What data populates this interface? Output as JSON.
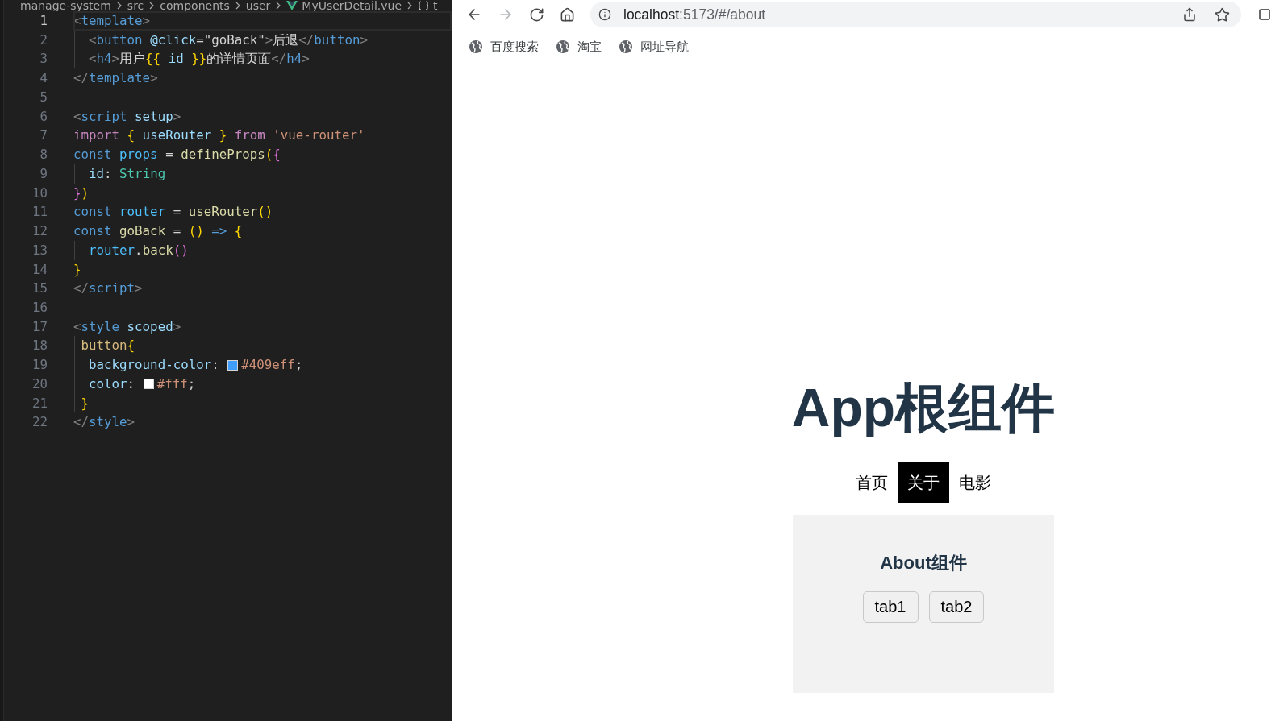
{
  "editor": {
    "breadcrumb": [
      {
        "kind": "folder",
        "label": "manage-system"
      },
      {
        "kind": "folder",
        "label": "src"
      },
      {
        "kind": "folder",
        "label": "components"
      },
      {
        "kind": "folder",
        "label": "user"
      },
      {
        "kind": "file",
        "label": "MyUserDetail.vue"
      },
      {
        "kind": "symbol",
        "label": "t"
      }
    ],
    "lines": [
      {
        "number": "1",
        "current": true,
        "tokens": [
          {
            "kind": "punct",
            "text": "<"
          },
          {
            "kind": "tag",
            "text": "template"
          },
          {
            "kind": "punct",
            "text": ">"
          }
        ]
      },
      {
        "number": "2",
        "current": false,
        "tokens": [
          {
            "kind": "punct",
            "text": "  <"
          },
          {
            "kind": "tag",
            "text": "button"
          },
          {
            "kind": "attr",
            "text": " @click"
          },
          {
            "kind": "text",
            "text": "=\"goBack\""
          },
          {
            "kind": "punct",
            "text": ">"
          },
          {
            "kind": "text",
            "text": "后退"
          },
          {
            "kind": "punct",
            "text": "</"
          },
          {
            "kind": "tag",
            "text": "button"
          },
          {
            "kind": "punct",
            "text": ">"
          }
        ]
      },
      {
        "number": "3",
        "current": false,
        "tokens": [
          {
            "kind": "punct",
            "text": "  <"
          },
          {
            "kind": "tag",
            "text": "h4"
          },
          {
            "kind": "punct",
            "text": ">"
          },
          {
            "kind": "text",
            "text": "用户"
          },
          {
            "kind": "bracket",
            "text": "{{"
          },
          {
            "kind": "variable",
            "text": " id "
          },
          {
            "kind": "bracket",
            "text": "}}"
          },
          {
            "kind": "text",
            "text": "的详情页面"
          },
          {
            "kind": "punct",
            "text": "</"
          },
          {
            "kind": "tag",
            "text": "h4"
          },
          {
            "kind": "punct",
            "text": ">"
          }
        ]
      },
      {
        "number": "4",
        "current": false,
        "tokens": [
          {
            "kind": "punct",
            "text": "</"
          },
          {
            "kind": "tag",
            "text": "template"
          },
          {
            "kind": "punct",
            "text": ">"
          }
        ]
      },
      {
        "number": "5",
        "current": false
      },
      {
        "number": "6",
        "current": false,
        "tokens": [
          {
            "kind": "punct",
            "text": "<"
          },
          {
            "kind": "tag",
            "text": "script"
          },
          {
            "kind": "attr",
            "text": " setup"
          },
          {
            "kind": "punct",
            "text": ">"
          }
        ]
      },
      {
        "number": "7",
        "current": false,
        "tokens": [
          {
            "kind": "control",
            "text": "import"
          },
          {
            "kind": "bracket",
            "text": " {"
          },
          {
            "kind": "variable",
            "text": " useRouter "
          },
          {
            "kind": "bracket",
            "text": "}"
          },
          {
            "kind": "control",
            "text": " from "
          },
          {
            "kind": "string",
            "text": "'vue-router'"
          }
        ]
      },
      {
        "number": "8",
        "current": false,
        "tokens": [
          {
            "kind": "keyword",
            "text": "const"
          },
          {
            "kind": "constant",
            "text": " props"
          },
          {
            "kind": "text",
            "text": " = "
          },
          {
            "kind": "function",
            "text": "defineProps"
          },
          {
            "kind": "bracket",
            "text": "("
          },
          {
            "kind": "bracket2",
            "text": "{"
          }
        ]
      },
      {
        "number": "9",
        "current": false,
        "tokens": [
          {
            "kind": "variable",
            "text": "  id"
          },
          {
            "kind": "text",
            "text": ": "
          },
          {
            "kind": "type",
            "text": "String"
          }
        ]
      },
      {
        "number": "10",
        "current": false,
        "tokens": [
          {
            "kind": "bracket2",
            "text": "}"
          },
          {
            "kind": "bracket",
            "text": ")"
          }
        ]
      },
      {
        "number": "11",
        "current": false,
        "tokens": [
          {
            "kind": "keyword",
            "text": "const"
          },
          {
            "kind": "constant",
            "text": " router"
          },
          {
            "kind": "text",
            "text": " = "
          },
          {
            "kind": "function",
            "text": "useRouter"
          },
          {
            "kind": "bracket",
            "text": "()"
          }
        ]
      },
      {
        "number": "12",
        "current": false,
        "tokens": [
          {
            "kind": "keyword",
            "text": "const"
          },
          {
            "kind": "function",
            "text": " goBack"
          },
          {
            "kind": "text",
            "text": " = "
          },
          {
            "kind": "bracket",
            "text": "()"
          },
          {
            "kind": "keyword",
            "text": " => "
          },
          {
            "kind": "bracket",
            "text": "{"
          }
        ]
      },
      {
        "number": "13",
        "current": false,
        "tokens": [
          {
            "kind": "constant",
            "text": "  router"
          },
          {
            "kind": "text",
            "text": "."
          },
          {
            "kind": "function",
            "text": "back"
          },
          {
            "kind": "bracket2",
            "text": "()"
          }
        ]
      },
      {
        "number": "14",
        "current": false,
        "tokens": [
          {
            "kind": "bracket",
            "text": "}"
          }
        ]
      },
      {
        "number": "15",
        "current": false,
        "tokens": [
          {
            "kind": "punct",
            "text": "</"
          },
          {
            "kind": "tag",
            "text": "script"
          },
          {
            "kind": "punct",
            "text": ">"
          }
        ]
      },
      {
        "number": "16",
        "current": false
      },
      {
        "number": "17",
        "current": false,
        "tokens": [
          {
            "kind": "punct",
            "text": "<"
          },
          {
            "kind": "tag",
            "text": "style"
          },
          {
            "kind": "attr",
            "text": " scoped"
          },
          {
            "kind": "punct",
            "text": ">"
          }
        ]
      },
      {
        "number": "18",
        "current": false,
        "tokens": [
          {
            "kind": "selector",
            "text": " button"
          },
          {
            "kind": "bracket",
            "text": "{"
          }
        ]
      },
      {
        "number": "19",
        "current": false,
        "tokens": [
          {
            "kind": "attr",
            "text": "  background-color"
          },
          {
            "kind": "text",
            "text": ": "
          },
          {
            "kind": "swatch",
            "color": "#409eff"
          },
          {
            "kind": "value",
            "text": "#409eff"
          },
          {
            "kind": "text",
            "text": ";"
          }
        ]
      },
      {
        "number": "20",
        "current": false,
        "tokens": [
          {
            "kind": "attr",
            "text": "  color"
          },
          {
            "kind": "text",
            "text": ": "
          },
          {
            "kind": "swatch",
            "color": "#ffffff"
          },
          {
            "kind": "value",
            "text": "#fff"
          },
          {
            "kind": "text",
            "text": ";"
          }
        ]
      },
      {
        "number": "21",
        "current": false,
        "tokens": [
          {
            "kind": "bracket",
            "text": " }"
          }
        ]
      },
      {
        "number": "22",
        "current": false,
        "tokens": [
          {
            "kind": "punct",
            "text": "</"
          },
          {
            "kind": "tag",
            "text": "style"
          },
          {
            "kind": "punct",
            "text": ">"
          }
        ]
      }
    ]
  },
  "browser": {
    "toolbar": {
      "back": {
        "disabled": false
      },
      "forward": {
        "disabled": true
      }
    },
    "address": {
      "host": "localhost",
      "path": ":5173/#/about"
    },
    "bookmarks": [
      {
        "label": "百度搜索"
      },
      {
        "label": "淘宝"
      },
      {
        "label": "网址导航"
      }
    ]
  },
  "page": {
    "title": "App根组件",
    "nav": [
      {
        "label": "首页",
        "selected": false
      },
      {
        "label": "关于",
        "selected": true
      },
      {
        "label": "电影",
        "selected": false
      }
    ],
    "panel": {
      "heading": "About组件",
      "buttons": [
        {
          "label": "tab1"
        },
        {
          "label": "tab2"
        }
      ]
    }
  }
}
